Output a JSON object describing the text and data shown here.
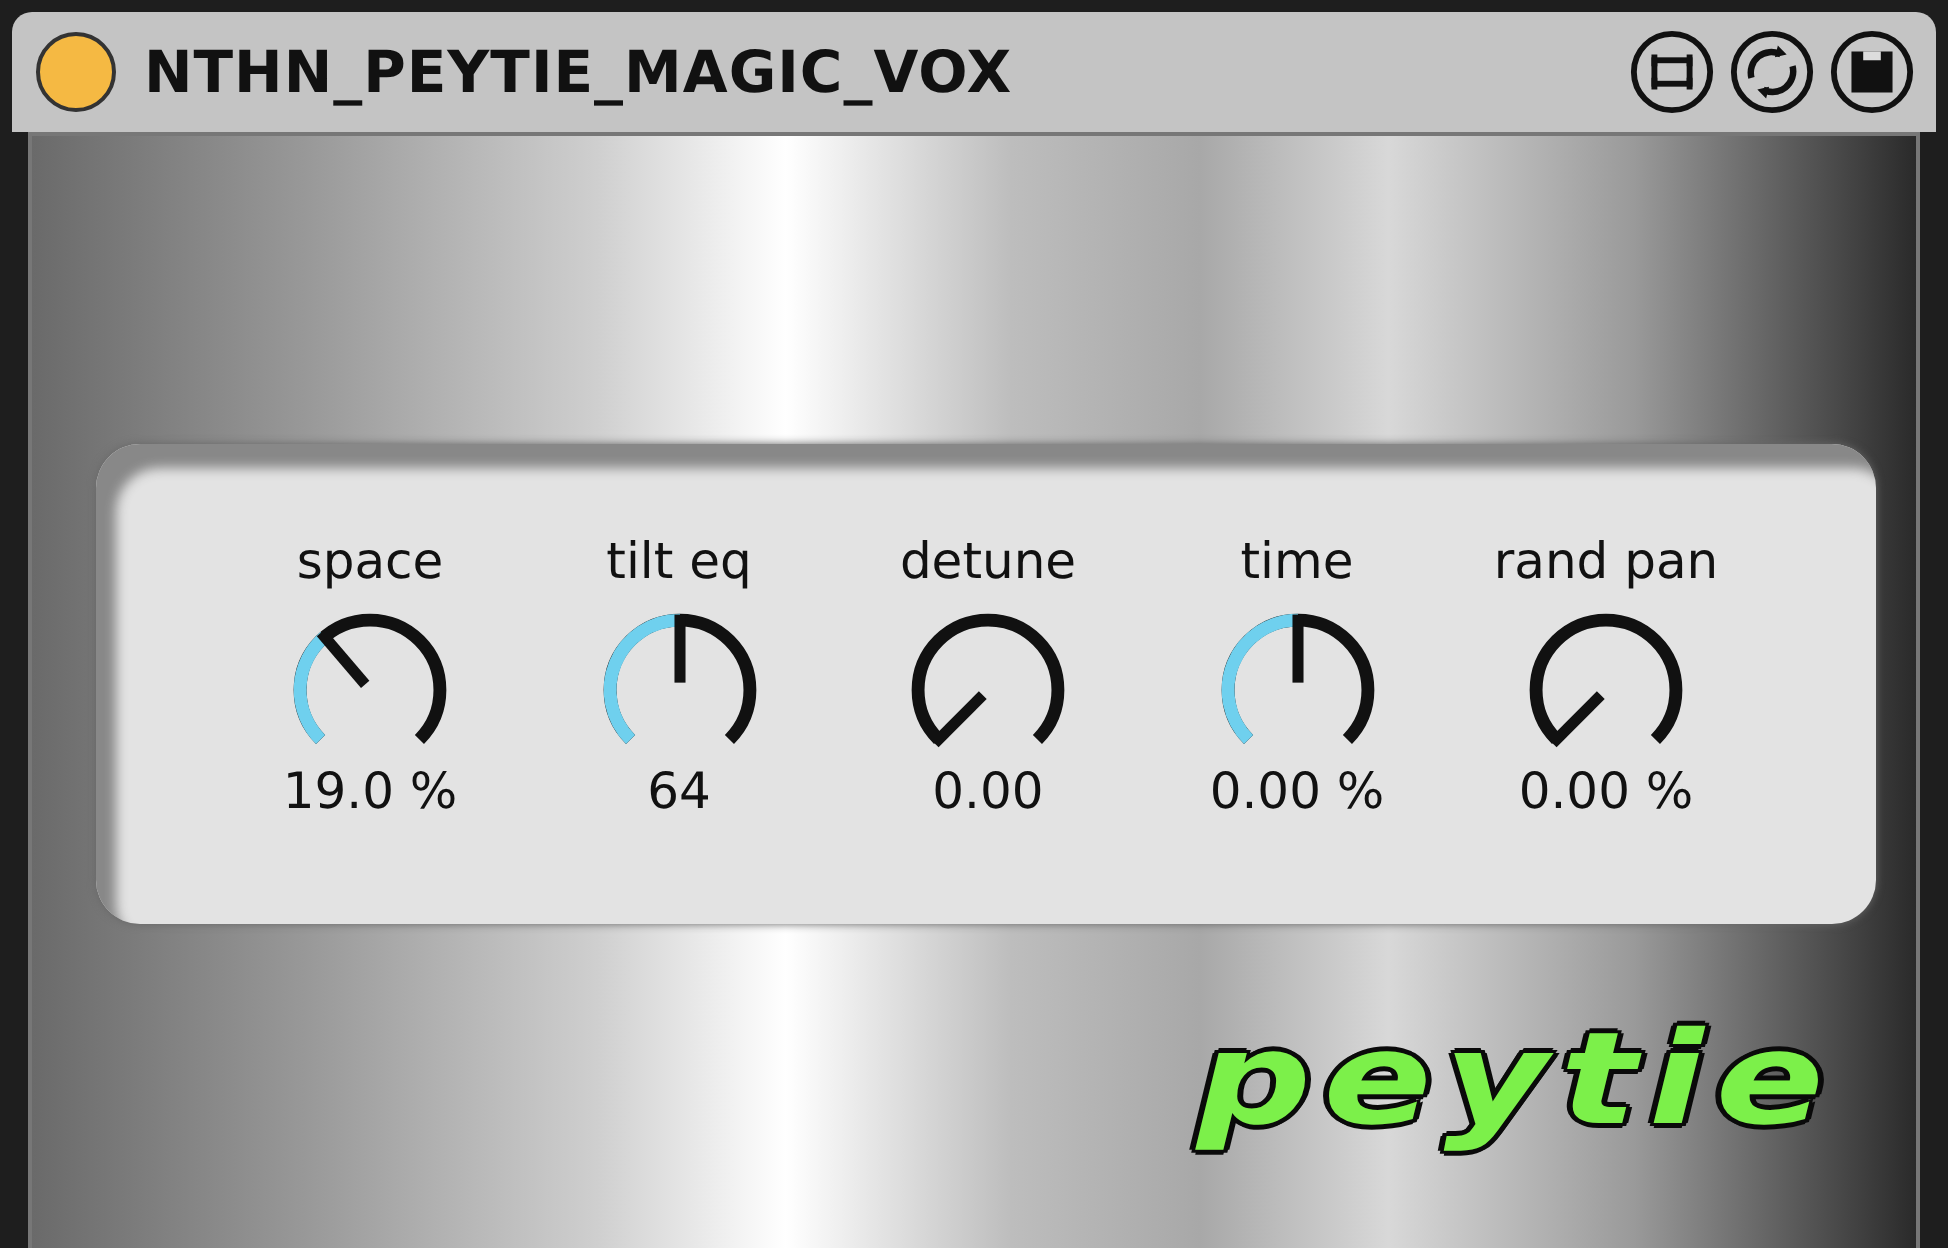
{
  "window": {
    "title": "NTHN_PEYTIE_MAGIC_VOX"
  },
  "knobs": [
    {
      "label": "space",
      "reading": "19.0 %"
    },
    {
      "label": "tilt eq",
      "reading": "64"
    },
    {
      "label": "detune",
      "reading": "0.00"
    },
    {
      "label": "time",
      "reading": "0.00 %"
    },
    {
      "label": "rand pan",
      "reading": "0.00 %"
    }
  ],
  "logo": {
    "text": "peytie"
  }
}
